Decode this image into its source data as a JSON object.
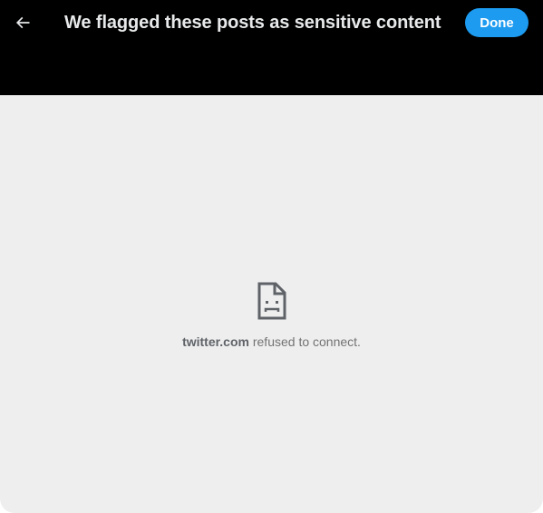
{
  "header": {
    "title": "We flagged these posts as sensitive content",
    "done_label": "Done",
    "back_icon": "arrow-left-icon"
  },
  "error": {
    "icon": "sad-page-icon",
    "host": "twitter.com",
    "message": " refused to connect."
  },
  "colors": {
    "header_bg": "#000000",
    "title": "#e7e9ea",
    "accent": "#1d9bf0",
    "content_bg": "#eeeeee",
    "error_text": "#737373"
  }
}
